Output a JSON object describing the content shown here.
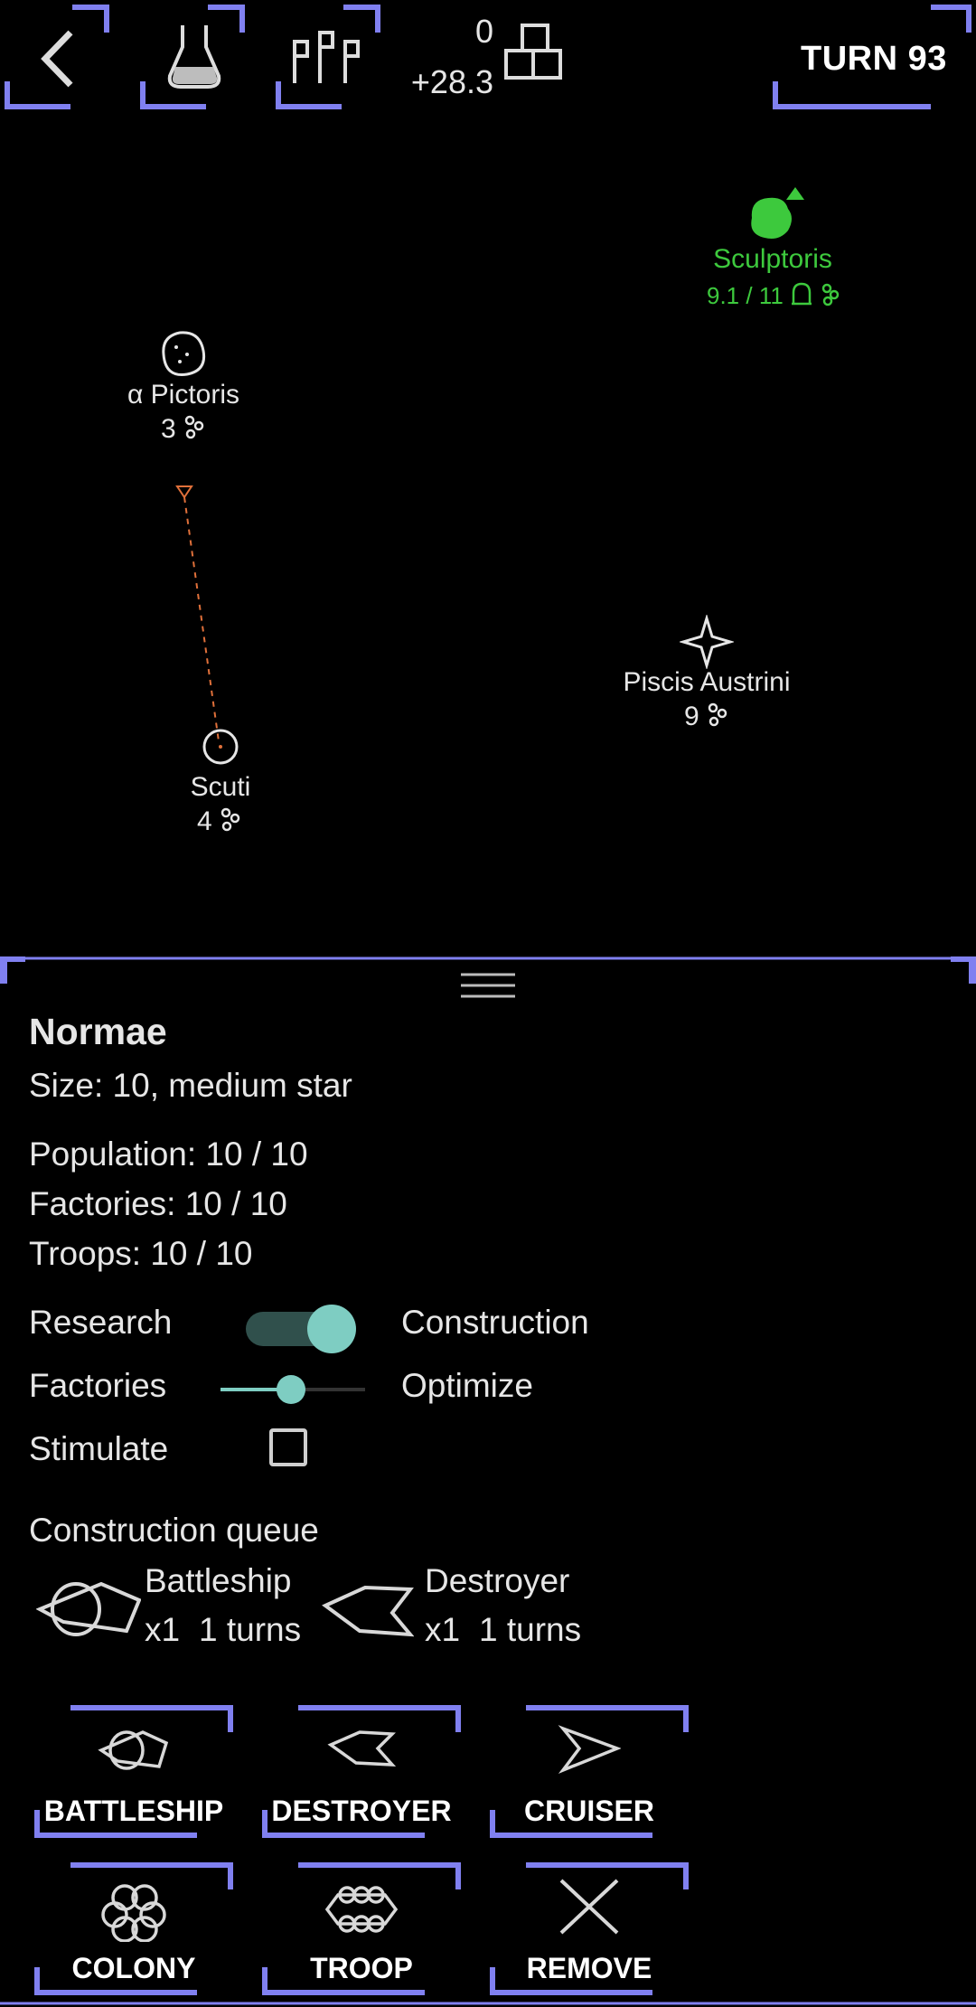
{
  "topbar": {
    "back": "back-arrow",
    "research": "flask-icon",
    "fleet": "flags-icon",
    "resource_value": "0",
    "resource_delta": "+28.3",
    "resource_icon": "blocks-icon",
    "turn": "TURN 93"
  },
  "map": {
    "stars": [
      {
        "name": "Sculptoris",
        "info": "9.1 / 11",
        "color": "#3dc93d",
        "icon": "green-planet-icon"
      },
      {
        "name": "α Pictoris",
        "pop": "3",
        "icon": "asteroid-star-icon"
      },
      {
        "name": "Piscis Austrini",
        "pop": "9",
        "icon": "compass-star-icon"
      },
      {
        "name": "Scuti",
        "pop": "4",
        "icon": "circle-star-icon"
      }
    ],
    "route_color": "#e0703a"
  },
  "panel": {
    "title": "Normae",
    "size": "Size: 10, medium star",
    "population": "Population: 10 / 10",
    "factories": "Factories: 10 / 10",
    "troops": "Troops: 10 / 10",
    "toggle": {
      "left": "Research",
      "right": "Construction",
      "on": true
    },
    "slider": {
      "left": "Factories",
      "right": "Optimize",
      "value": 0.5
    },
    "stimulate": {
      "label": "Stimulate",
      "checked": false
    },
    "queue_title": "Construction queue",
    "queue": [
      {
        "name": "Battleship",
        "count": "x1",
        "turns": "1 turns"
      },
      {
        "name": "Destroyer",
        "count": "x1",
        "turns": "1 turns"
      }
    ],
    "buttons": [
      {
        "label": "BATTLESHIP",
        "icon": "battleship-icon"
      },
      {
        "label": "DESTROYER",
        "icon": "destroyer-icon"
      },
      {
        "label": "CRUISER",
        "icon": "cruiser-icon"
      },
      {
        "label": "COLONY",
        "icon": "colony-icon"
      },
      {
        "label": "TROOP",
        "icon": "troop-icon"
      },
      {
        "label": "REMOVE",
        "icon": "close-icon"
      }
    ],
    "accent": "#8080f0",
    "toggle_color": "#7ecdc2"
  }
}
